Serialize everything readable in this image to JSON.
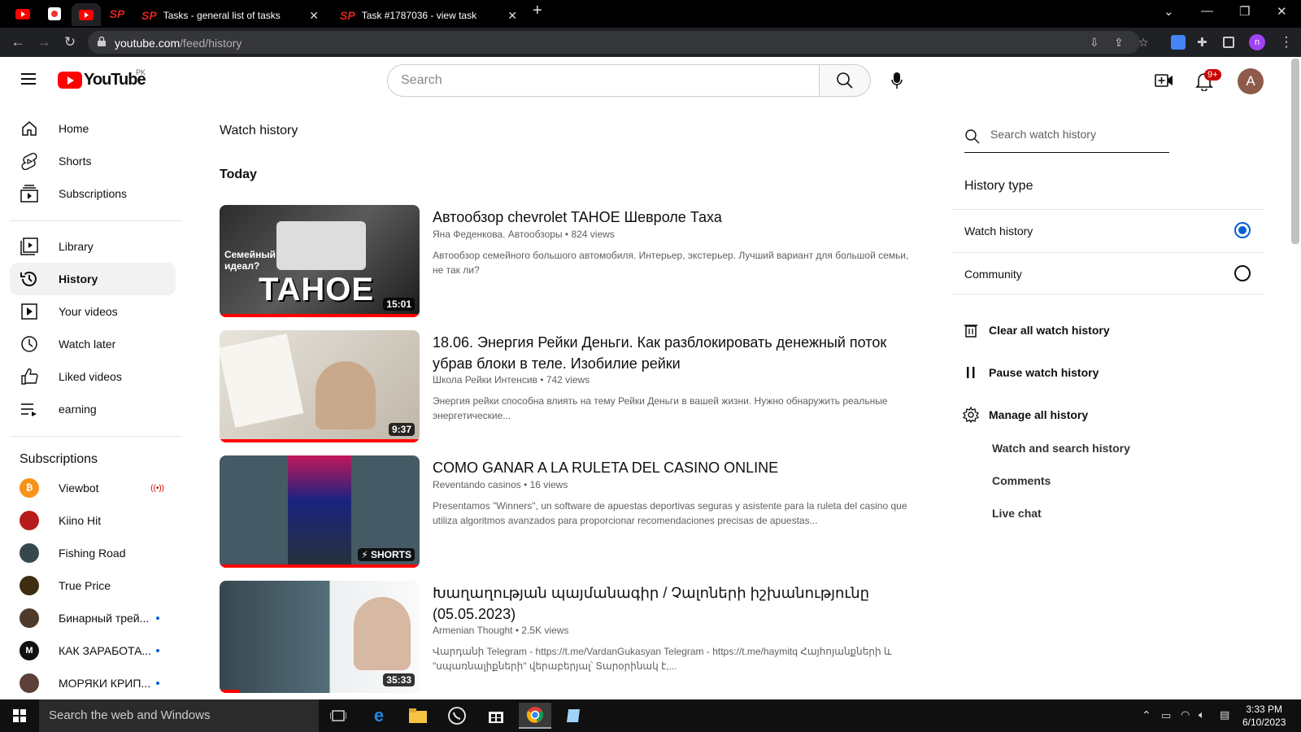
{
  "browser": {
    "tabs": [
      {
        "label": "Tasks - general list of tasks"
      },
      {
        "label": "Task #1787036 - view task"
      }
    ],
    "url_host": "youtube.com",
    "url_path": "/feed/history",
    "profile_initial": "n"
  },
  "header": {
    "logo_text": "YouTube",
    "country_code": "PK",
    "search_placeholder": "Search",
    "notification_count": "9+",
    "user_initial": "A"
  },
  "sidebar": {
    "items": [
      {
        "label": "Home",
        "icon": "home-icon"
      },
      {
        "label": "Shorts",
        "icon": "shorts-icon"
      },
      {
        "label": "Subscriptions",
        "icon": "subscriptions-icon"
      },
      {
        "label": "Library",
        "icon": "library-icon"
      },
      {
        "label": "History",
        "icon": "history-icon"
      },
      {
        "label": "Your videos",
        "icon": "your-videos-icon"
      },
      {
        "label": "Watch later",
        "icon": "clock-icon"
      },
      {
        "label": "Liked videos",
        "icon": "thumb-up-icon"
      },
      {
        "label": "earning",
        "icon": "playlist-icon"
      }
    ],
    "subscriptions_title": "Subscriptions",
    "subscriptions": [
      {
        "name": "Viewbot",
        "status": "live",
        "color": "#f7931a"
      },
      {
        "name": "Kiino Hit",
        "status": "",
        "color": "#b71c1c"
      },
      {
        "name": "Fishing Road",
        "status": "",
        "color": "#37474f"
      },
      {
        "name": "True Price",
        "status": "",
        "color": "#3e2e14"
      },
      {
        "name": "Бинарный трей...",
        "status": "new",
        "color": "#4e3b2a"
      },
      {
        "name": "КАК ЗАРАБОТА...",
        "status": "new",
        "color": "#111111"
      },
      {
        "name": "МОРЯКИ КРИП...",
        "status": "new",
        "color": "#5d4037"
      }
    ]
  },
  "main": {
    "page_title": "Watch history",
    "section_title": "Today",
    "videos": [
      {
        "title": "Автообзор chevrolet TAHOE Шевроле Таха",
        "channel": "Яна Феденкова. Автообзоры",
        "views": "824 views",
        "description": "Автообзор семейного большого автомобиля. Интерьер, экстерьер. Лучший вариант для большой семьи, не так ли?",
        "duration": "15:01",
        "thumb_text_big": "TAHOE",
        "thumb_text_small": "Семейный идеал?",
        "progress": 1.0
      },
      {
        "title": "18.06. Энергия Рейки Деньги. Как разблокировать денежный поток убрав блоки в теле. Изобилие рейки",
        "channel": "Школа Рейки Интенсив",
        "views": "742 views",
        "description": "Энергия рейки способна влиять на тему Рейки Деньги в вашей жизни. Нужно обнаружить реальные энергетические...",
        "duration": "9:37",
        "progress": 1.0
      },
      {
        "title": "COMO GANAR A LA RULETA DEL CASINO ONLINE",
        "channel": "Reventando casinos",
        "views": "16 views",
        "description": "Presentamos \"Winners\", un software de apuestas deportivas seguras y asistente para la ruleta del casino que utiliza algoritmos avanzados para proporcionar recomendaciones precisas de apuestas...",
        "duration": "SHORTS",
        "progress": 1.0
      },
      {
        "title": "Խաղաղության պայմանագիր / Չալոների իշխանությունը (05.05.2023)",
        "channel": "Armenian Thought",
        "views": "2.5K views",
        "description": "Վարդանի Telegram - https://t.me/VardanGukasyan Telegram - https://t.me/haymitq Հայհոյանքների և \"սպառնալիքների\" վերաբերյալ՝ Տարօրինակ է,...",
        "duration": "35:33",
        "progress": 0.1
      }
    ]
  },
  "right_panel": {
    "search_placeholder": "Search watch history",
    "history_type_title": "History type",
    "options": [
      {
        "label": "Watch history",
        "selected": true
      },
      {
        "label": "Community",
        "selected": false
      }
    ],
    "actions": [
      {
        "label": "Clear all watch history"
      },
      {
        "label": "Pause watch history"
      },
      {
        "label": "Manage all history"
      }
    ],
    "sub_links": [
      "Watch and search history",
      "Comments",
      "Live chat"
    ]
  },
  "taskbar": {
    "search_text": "Search the web and Windows",
    "time": "3:33 PM",
    "date": "6/10/2023"
  },
  "colors": {
    "accent_red": "#ff0000",
    "link_blue": "#065fd4"
  }
}
